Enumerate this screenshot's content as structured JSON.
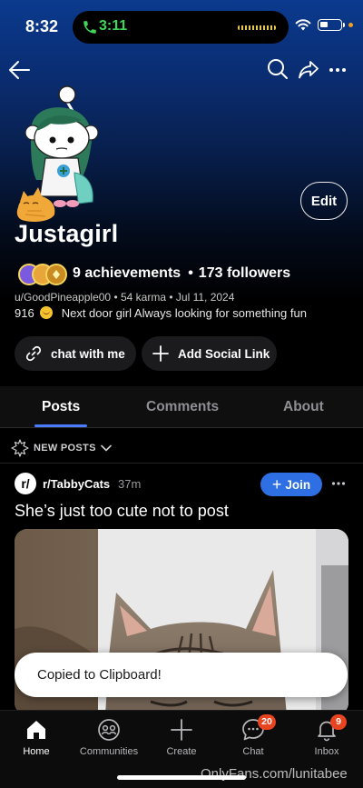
{
  "status_bar": {
    "time": "8:32",
    "call_timer": "3:11"
  },
  "profile": {
    "display_name": "Justagirl",
    "edit_label": "Edit",
    "achievements": "9 achievements",
    "followers": "173 followers",
    "stats_separator": "•",
    "username": "u/GoodPineapple00",
    "karma": "54 karma",
    "joined": "Jul 11, 2024",
    "meta_separator": "•",
    "bio_count": "916",
    "bio_text": "Next door girl  Always looking for something fun",
    "buttons": {
      "chat_label": "chat with me",
      "social_label": "Add Social Link"
    }
  },
  "tabs": [
    {
      "label": "Posts",
      "active": true
    },
    {
      "label": "Comments",
      "active": false
    },
    {
      "label": "About",
      "active": false
    }
  ],
  "feed": {
    "sort_label": "NEW POSTS"
  },
  "post": {
    "subreddit_icon": "r/",
    "subreddit": "r/TabbyCats",
    "age": "37m",
    "join_label": "Join",
    "title": "She’s just too cute not to post"
  },
  "toast": {
    "message": "Copied to Clipboard!"
  },
  "bottom_nav": [
    {
      "label": "Home",
      "icon": "home-icon",
      "active": true
    },
    {
      "label": "Communities",
      "icon": "communities-icon"
    },
    {
      "label": "Create",
      "icon": "plus-icon"
    },
    {
      "label": "Chat",
      "icon": "chat-icon",
      "badge": "20"
    },
    {
      "label": "Inbox",
      "icon": "bell-icon",
      "badge": "9"
    }
  ],
  "watermark": "OnlyFans.com/lunitabee",
  "colors": {
    "accent": "#2f6fe4",
    "tab_underline": "#4b7bff",
    "badge": "#e8441f",
    "call_green": "#3fd75a"
  }
}
